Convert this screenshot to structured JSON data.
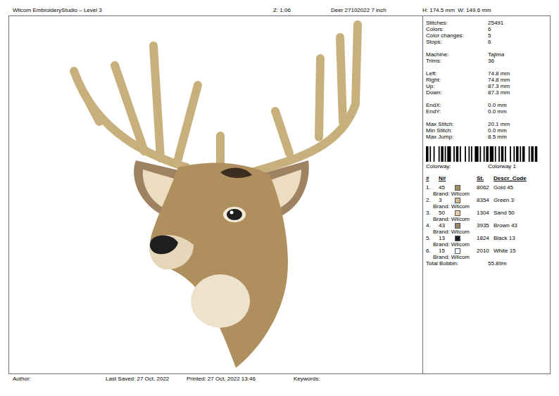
{
  "header": {
    "app": "Wilcom EmbroideryStudio – Level 3",
    "zoom": "Z: 1:06",
    "file": "Deer 27102022 7 inch",
    "size": "H: 174.5 mm  W: 149.6 mm"
  },
  "stat_groups": [
    [
      {
        "label": "Stitches:",
        "value": "25491"
      },
      {
        "label": "Colors:",
        "value": "6"
      },
      {
        "label": "Color changes:",
        "value": "5"
      },
      {
        "label": "Stops:",
        "value": "6"
      }
    ],
    [
      {
        "label": "Machine:",
        "value": "Tajima"
      },
      {
        "label": "Trims:",
        "value": "36"
      }
    ],
    [
      {
        "label": "Left:",
        "value": "74.8 mm"
      },
      {
        "label": "Right:",
        "value": "74.8 mm"
      },
      {
        "label": "Up:",
        "value": "87.3 mm"
      },
      {
        "label": "Down:",
        "value": "87.3 mm"
      }
    ],
    [
      {
        "label": "EndX:",
        "value": "0.0 mm"
      },
      {
        "label": "EndY:",
        "value": "0.0 mm"
      }
    ],
    [
      {
        "label": "Max Stitch:",
        "value": "20.1 mm"
      },
      {
        "label": "Min Stitch:",
        "value": "0.0 mm"
      },
      {
        "label": "Max Jump:",
        "value": "8.5 mm"
      }
    ]
  ],
  "colorway": {
    "label": "Colorway:",
    "value": "Colorway 1"
  },
  "columns": [
    "#",
    "N#",
    "St.",
    "Descr_Code"
  ],
  "threads": [
    {
      "index": "1.",
      "n": "45",
      "color": "#a8905c",
      "st": "8062",
      "descr": "Gold 45",
      "brand": "Brand: Wilcom"
    },
    {
      "index": "2.",
      "n": "3",
      "color": "#d6bb8c",
      "st": "8354",
      "descr": "Green 3",
      "brand": "Brand: Wilcom"
    },
    {
      "index": "3.",
      "n": "50",
      "color": "#ecc9a0",
      "st": "1304",
      "descr": "Sand 50",
      "brand": "Brand: Wilcom"
    },
    {
      "index": "4.",
      "n": "43",
      "color": "#9e8262",
      "st": "3935",
      "descr": "Brown 43",
      "brand": "Brand: Wilcom"
    },
    {
      "index": "5.",
      "n": "13",
      "color": "#1e1e1e",
      "st": "1824",
      "descr": "Black 13",
      "brand": "Brand: Wilcom"
    },
    {
      "index": "6.",
      "n": "15",
      "color": "#ffffff",
      "st": "2010",
      "descr": "White 15",
      "brand": "Brand: Wilcom"
    }
  ],
  "total": {
    "label": "Total Bobbin:",
    "value": "55.89m"
  },
  "footer": [
    "Author:",
    "Last Saved: 27 Oct, 2022",
    "Printed: 27 Oct, 2022 13:46",
    "Keywords:"
  ]
}
